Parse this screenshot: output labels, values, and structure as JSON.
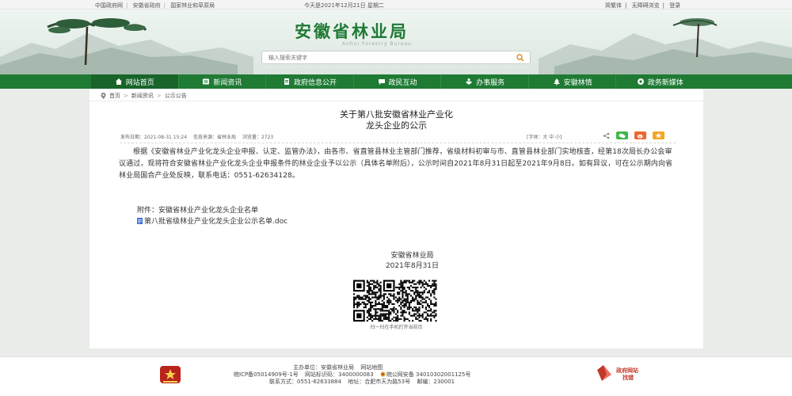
{
  "topbar": {
    "links": [
      "中国政府网",
      "安徽省政府",
      "国家林业和草原局"
    ],
    "date": "今天是2021年12月21日 星期二",
    "right_links": [
      "简繁体",
      "无障碍浏览",
      "登录"
    ]
  },
  "header": {
    "title": "安徽省林业局",
    "subtitle": "Anhui Forestry Bureau",
    "search_placeholder": "输入搜索关键字"
  },
  "nav": {
    "items": [
      {
        "label": "网站首页",
        "icon": "home-icon"
      },
      {
        "label": "新闻资讯",
        "icon": "news-icon"
      },
      {
        "label": "政府信息公开",
        "icon": "document-icon"
      },
      {
        "label": "政民互动",
        "icon": "chat-icon"
      },
      {
        "label": "办事服务",
        "icon": "service-icon"
      },
      {
        "label": "安徽林情",
        "icon": "tree-icon"
      },
      {
        "label": "政务新媒体",
        "icon": "media-icon"
      }
    ]
  },
  "breadcrumb": [
    "首页",
    "新闻资讯",
    "公示公告"
  ],
  "article": {
    "title_line1": "关于第八批安徽省林业产业化",
    "title_line2": "龙头企业的公示",
    "publish_date": "发布日期：2021-08-31 15:24",
    "source": "信息来源：省林业局",
    "views": "浏览量：2723",
    "font_size": "[字体：大 中 小]",
    "body": "根据《安徽省林业产业化龙头企业申报、认定、监管办法》，由各市、省直管县林业主管部门推荐，省级材料初审与市、直管县林业部门实地核查，经第18次局长办公会审议通过，现将符合安徽省林业产业化龙头企业申报条件的林业企业予以公示（具体名单附后），公示时间自2021年8月31日起至2021年9月8日。如有异议，可在公示期内向省林业局国合产业处反映，联系电话：0551-62634128。",
    "attachment_label": "附件：安徽省林业产业化龙头企业名单",
    "attachment_file": "第八批省级林业产业化龙头企业公示名单.doc",
    "signature_org": "安徽省林业局",
    "signature_date": "2021年8月31日",
    "qr_caption": "扫一扫在手机打开当前页"
  },
  "footer": {
    "line1": [
      "主办单位：安徽省林业局",
      "网站地图"
    ],
    "line2": [
      "皖ICP备05014909号-1号",
      "网站标识码：3400000083",
      "皖公网安备 34010302001125号"
    ],
    "line3": [
      "联系方式：0551-62633884",
      "地址：合肥市天为路53号",
      "邮编：230001"
    ],
    "jiucuo_line1": "政府网站",
    "jiucuo_line2": "找错"
  },
  "colors": {
    "brand_green": "#1f7a34",
    "nav_active": "#186429",
    "page_bg": "#e9ece9"
  }
}
